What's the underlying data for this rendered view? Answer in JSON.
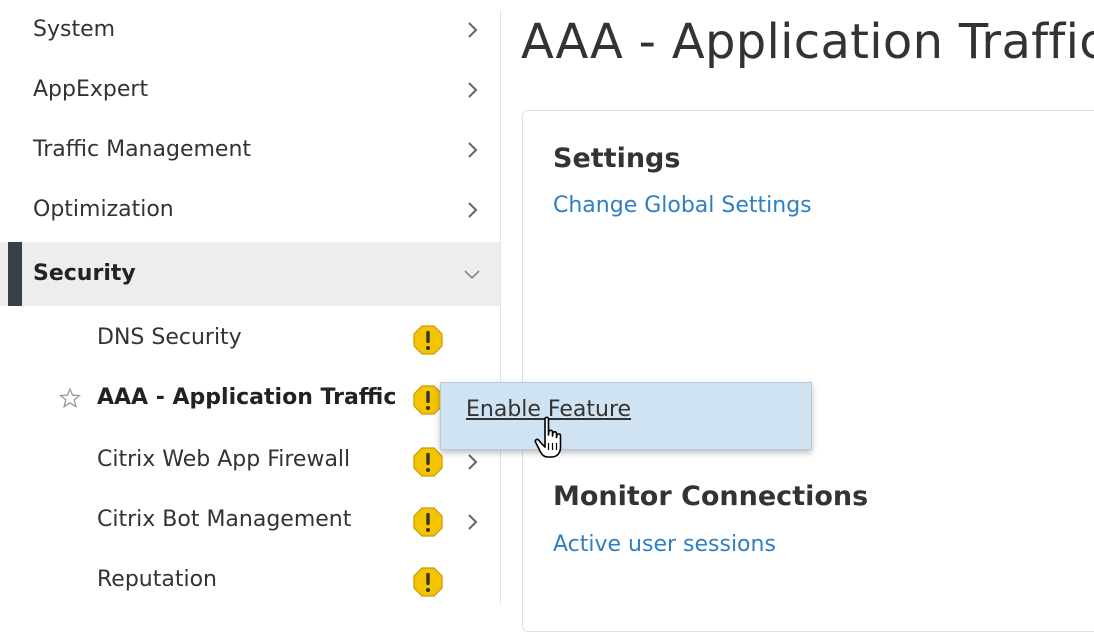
{
  "sidebar": {
    "items": [
      {
        "label": "System"
      },
      {
        "label": "AppExpert"
      },
      {
        "label": "Traffic Management"
      },
      {
        "label": "Optimization"
      },
      {
        "label": "Security"
      }
    ],
    "security_subitems": [
      {
        "label": "DNS Security"
      },
      {
        "label": "AAA - Application Traffic"
      },
      {
        "label": "Citrix Web App Firewall"
      },
      {
        "label": "Citrix Bot Management"
      },
      {
        "label": "Reputation"
      }
    ]
  },
  "main": {
    "page_title": "AAA - Application Traffic",
    "settings": {
      "title": "Settings",
      "link": "Change Global Settings"
    },
    "monitor": {
      "title": "Monitor Connections",
      "link": "Active user sessions"
    }
  },
  "context_menu": {
    "item": "Enable Feature"
  },
  "colors": {
    "link": "#2f7fc1",
    "active_bar": "#3a3f4c",
    "warning": "#f5c400",
    "menu_bg": "#cfe3f2"
  }
}
